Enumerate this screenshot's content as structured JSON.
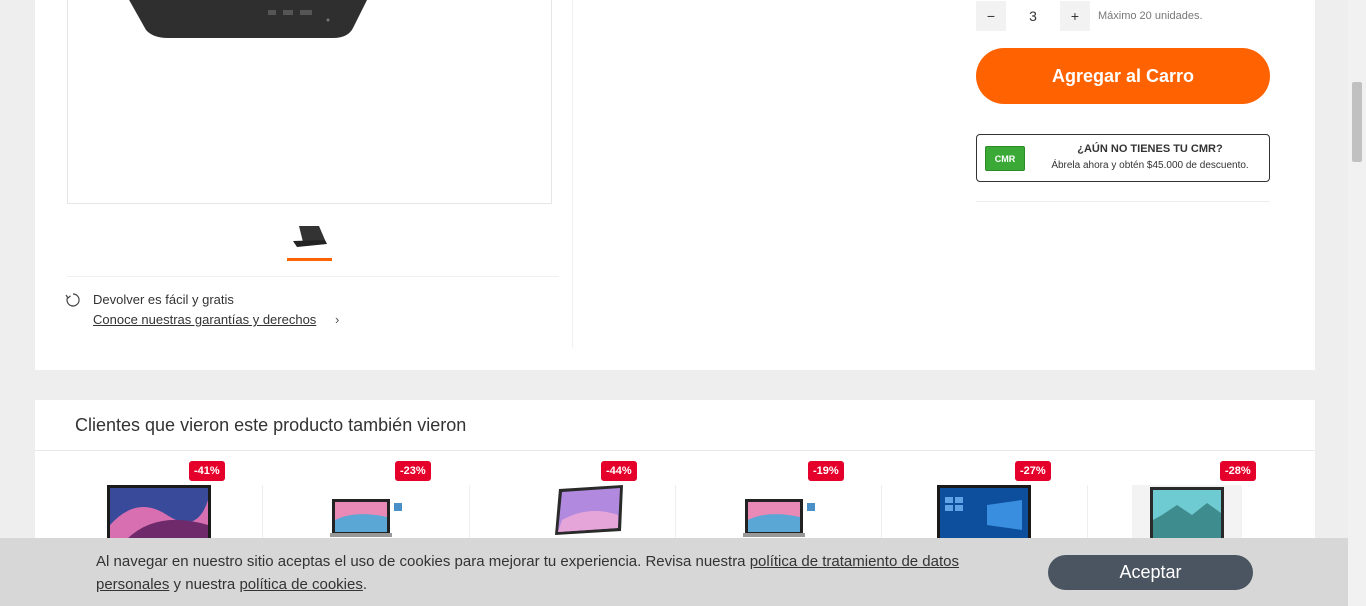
{
  "gallery": {
    "thumbnail_icon": "laptop-thumbnail"
  },
  "returns": {
    "title": "Devolver es fácil y gratis",
    "link": "Conoce nuestras garantías y derechos",
    "icon": "return-arrow-icon"
  },
  "quantity": {
    "minus_label": "−",
    "value": "3",
    "plus_label": "+",
    "max_note": "Máximo 20 unidades."
  },
  "cart": {
    "button_label": "Agregar al Carro"
  },
  "cmr": {
    "logo_text": "CMR",
    "title": "¿AÚN NO TIENES TU CMR?",
    "subtitle": "Ábrela ahora y obtén $45.000 de descuento."
  },
  "recommendations": {
    "title": "Clientes que vieron este producto también vieron",
    "items": [
      {
        "discount": "-41%"
      },
      {
        "discount": "-23%"
      },
      {
        "discount": "-44%"
      },
      {
        "discount": "-19%"
      },
      {
        "discount": "-27%"
      },
      {
        "discount": "-28%"
      }
    ]
  },
  "cookies": {
    "text_before": "Al navegar en nuestro sitio aceptas el uso de cookies para mejorar tu experiencia. Revisa nuestra ",
    "link_privacy": "política de tratamiento de datos personales",
    "text_middle": " y nuestra ",
    "link_cookies": "política de cookies",
    "text_after": ".",
    "accept_label": "Aceptar"
  },
  "colors": {
    "accent": "#ff6200",
    "badge": "#e4002b",
    "cmr_green": "#3aa935",
    "accept_button": "#4b5561"
  }
}
